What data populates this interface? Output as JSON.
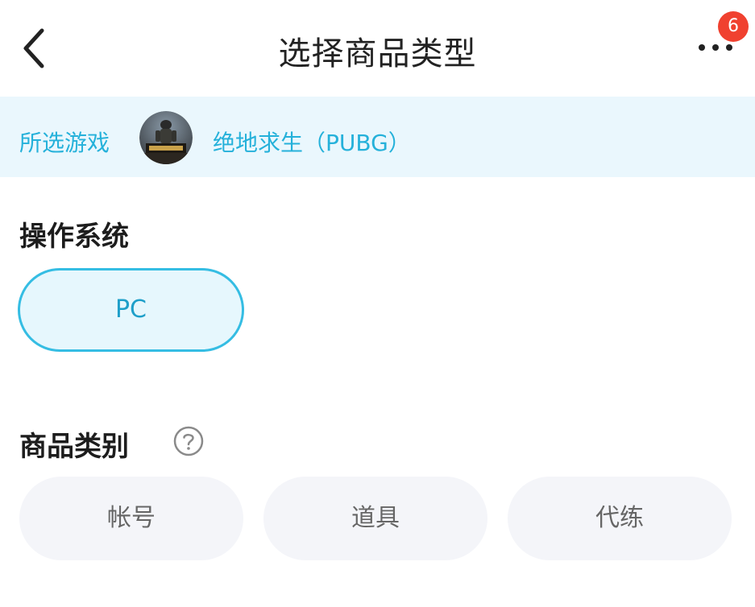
{
  "header": {
    "title": "选择商品类型",
    "notification_count": "6"
  },
  "game_bar": {
    "label": "所选游戏",
    "game_name": "绝地求生（PUBG）"
  },
  "os_section": {
    "title": "操作系统",
    "options": [
      "PC"
    ],
    "selected": "PC"
  },
  "category_section": {
    "title": "商品类别",
    "options": [
      "帐号",
      "道具",
      "代练"
    ]
  },
  "colors": {
    "accent": "#25b1da",
    "selected_border": "#35bde3",
    "badge": "#f0412f",
    "chip_bg": "#f4f5f9"
  }
}
